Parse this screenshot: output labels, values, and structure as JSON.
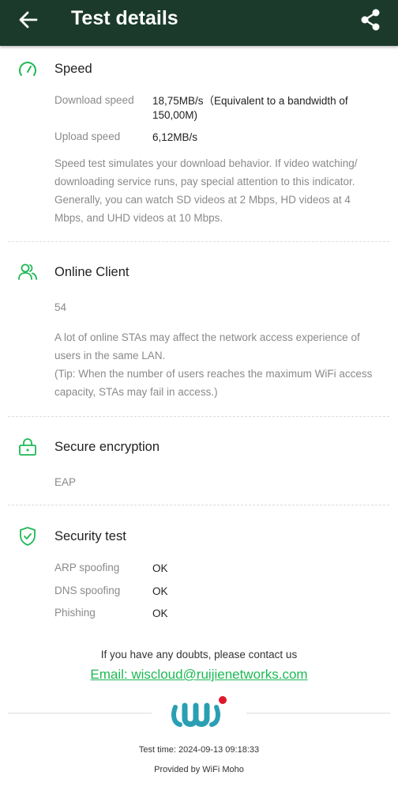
{
  "header": {
    "title": "Test details",
    "back_icon": "arrow-left-icon",
    "share_icon": "share-icon",
    "bg_color": "#1b3a2b"
  },
  "speed": {
    "title": "Speed",
    "icon": "speedometer-icon",
    "download_label": "Download speed",
    "download_value": "18,75MB/s（Equivalent to a bandwidth of 150,00M)",
    "upload_label": "Upload speed",
    "upload_value": "6,12MB/s",
    "description": "Speed test simulates your download behavior. If video watching/ downloading service runs, pay special attention to this indicator. Generally, you can watch SD videos at 2 Mbps, HD videos at 4 Mbps, and UHD videos at 10 Mbps."
  },
  "online_client": {
    "title": "Online Client",
    "icon": "users-icon",
    "count": "54",
    "description": "A lot of online STAs may affect the network access experience of users in the same LAN.",
    "tip": "(Tip: When the number of users reaches the maximum WiFi access capacity, STAs may fail in access.)"
  },
  "encryption": {
    "title": "Secure encryption",
    "icon": "lock-icon",
    "value": "EAP"
  },
  "security_test": {
    "title": "Security test",
    "icon": "shield-check-icon",
    "rows": [
      {
        "label": "ARP spoofing",
        "value": "OK"
      },
      {
        "label": "DNS spoofing",
        "value": "OK"
      },
      {
        "label": "Phishing",
        "value": "OK"
      }
    ]
  },
  "contact": {
    "text": "If you have any doubts, please contact us",
    "email": "Email: wiscloud@ruijienetworks.com"
  },
  "footer": {
    "test_time": "Test time: 2024-09-13 09:18:33",
    "provided_by": "Provided by WiFi Moho"
  },
  "colors": {
    "accent": "#1db954",
    "label_gray": "#8a8a8a",
    "logo_teal": "#2a9fb3",
    "logo_red": "#e0192a"
  }
}
